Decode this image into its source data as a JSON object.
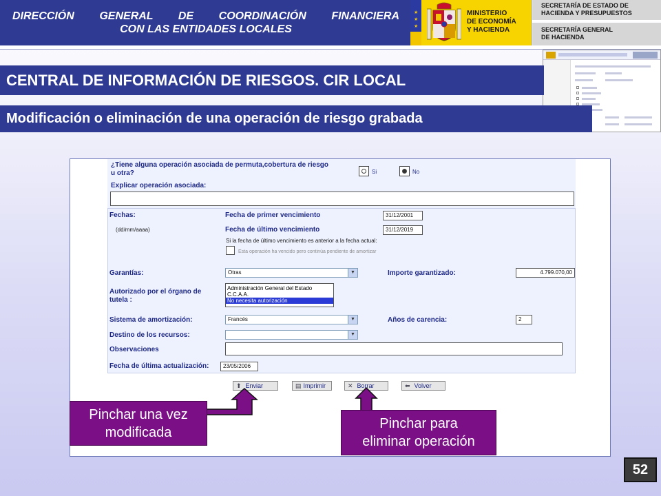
{
  "header": {
    "directorate_line1": "DIRECCIÓN GENERAL DE COORDINACIÓN FINANCIERA",
    "directorate_line2": "CON LAS ENTIDADES LOCALES",
    "ministry_line1": "MINISTERIO",
    "ministry_line2": "DE ECONOMÍA",
    "ministry_line3": "Y HACIENDA",
    "secretaria1_line1": "SECRETARÍA DE ESTADO DE",
    "secretaria1_line2": "HACIENDA Y PRESUPUESTOS",
    "secretaria2_line1": "SECRETARÍA GENERAL",
    "secretaria2_line2": "DE HACIENDA",
    "brand_color": "#2f3a93",
    "yellow_color": "#f7d300"
  },
  "title": "CENTRAL DE INFORMACIÓN DE RIESGOS. CIR LOCAL",
  "subtitle": "Modificación o eliminación de una operación de riesgo grabada",
  "form": {
    "q_permuta_line1": "¿Tiene alguna operación asociada de permuta,cobertura de riesgo",
    "q_permuta_line2": "u otra?",
    "radio_si_label": "Si",
    "radio_no_label": "No",
    "radio_selected": "No",
    "explicar_label": "Explicar operación asociada:",
    "explicar_value": "",
    "fechas_label": "Fechas:",
    "fechas_format": "(dd/mm/aaaa)",
    "primer_venc_label": "Fecha de primer vencimiento",
    "primer_venc_value": "31/12/2001",
    "ultimo_venc_label": "Fecha de último vencimiento",
    "ultimo_venc_value": "31/12/2019",
    "nota_vencimiento": "Si la fecha de último vencimiento es anterior a la fecha actual:",
    "check_vencida_label": "Esta operación ha vencido pero continúa pendiente de amortizar",
    "garantias_label": "Garantías:",
    "garantias_value": "Otras",
    "importe_label": "Importe garantizado:",
    "importe_value": "4.799.070,00",
    "autorizado_label_line1": "Autorizado por el órgano de",
    "autorizado_label_line2": "tutela :",
    "autorizado_options": [
      "Administración General del Estado",
      "C.C.A.A.",
      "No necesita autorización"
    ],
    "autorizado_selected_index": 2,
    "sistema_label": "Sistema de  amortización:",
    "sistema_value": "Francés",
    "carencia_label": "Años de carencia:",
    "carencia_value": "2",
    "destino_label": "Destino de los recursos:",
    "destino_value": "",
    "observaciones_label": "Observaciones",
    "observaciones_value": "",
    "actualizacion_label": "Fecha de última actualización:",
    "actualizacion_value": "23/05/2006"
  },
  "buttons": {
    "enviar": "Enviar",
    "imprimir": "Imprimir",
    "borrar": "Borrar",
    "volver": "Volver"
  },
  "callouts": {
    "enviar_line1": "Pinchar una vez",
    "enviar_line2": "modificada",
    "borrar_line1": "Pinchar para",
    "borrar_line2": "eliminar operación",
    "color": "#7a0f86"
  },
  "page_number": "52"
}
